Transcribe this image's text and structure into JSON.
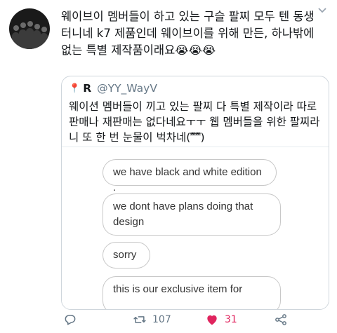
{
  "tweet": {
    "text": "웨이브이 멤버들이 하고 있는 구슬 팔찌 모두 텐 동생 터니네 k7 제품인데 웨이브이를 위해 만든, 하나밖에 없는 특별 제작품이래요😭😭😭"
  },
  "quote": {
    "name": "R",
    "handle": "@YY_WayV",
    "text": "웨이션 멤버들이 끼고 있는 팔찌 다 특별 제작이라 따로 판매나 재판매는 없다네요ㅜㅜ 웹 멤버들을 위한 팔찌라니 또 한 번 눈물이 벅차네(ʺ̿̇̿ʺ̿̇̿)",
    "messages": [
      "we have black and white edition .",
      "we dont have plans doing that\ndesign",
      "sorry",
      "this is our exclusive item for"
    ]
  },
  "actions": {
    "reply_icon": "reply-icon",
    "retweet_icon": "retweet-icon",
    "retweet_count": "107",
    "like_icon": "heart-icon",
    "like_count": "31",
    "share_icon": "share-icon"
  },
  "colors": {
    "like": "#e0245e",
    "muted": "#657786",
    "border": "#cfd6dc"
  }
}
